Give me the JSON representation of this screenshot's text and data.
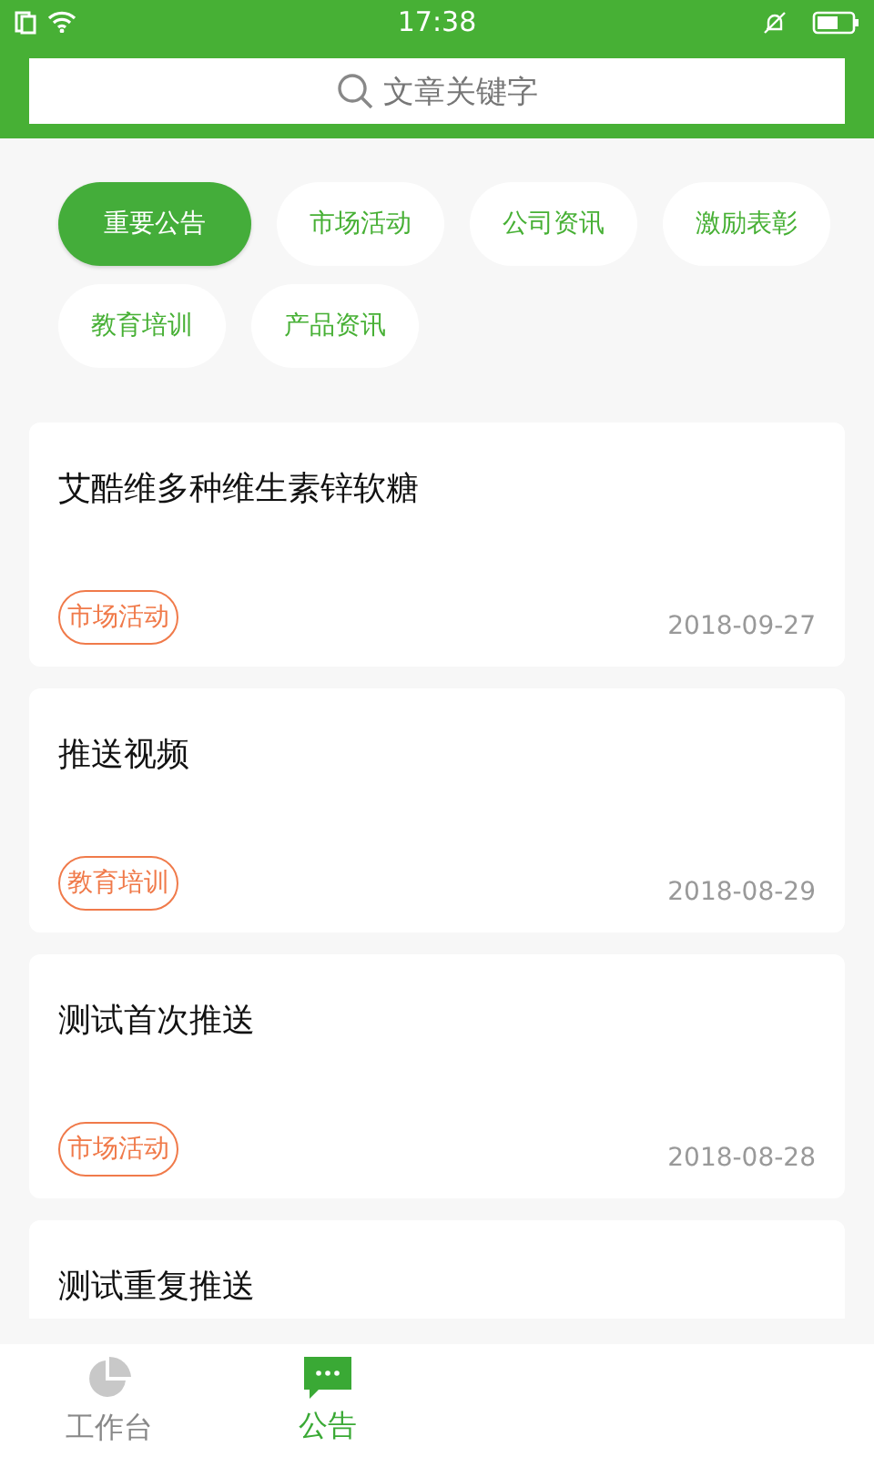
{
  "status_bar": {
    "time": "17:38"
  },
  "search": {
    "placeholder": "文章关键字"
  },
  "categories": [
    {
      "label": "重要公告",
      "selected": true
    },
    {
      "label": "市场活动",
      "selected": false
    },
    {
      "label": "公司资讯",
      "selected": false
    },
    {
      "label": "激励表彰",
      "selected": false
    },
    {
      "label": "教育培训",
      "selected": false
    },
    {
      "label": "产品资讯",
      "selected": false
    }
  ],
  "articles": [
    {
      "title": "艾酷维多种维生素锌软糖",
      "tag": "市场活动",
      "date": "2018-09-27"
    },
    {
      "title": "推送视频",
      "tag": "教育培训",
      "date": "2018-08-29"
    },
    {
      "title": "测试首次推送",
      "tag": "市场活动",
      "date": "2018-08-28"
    },
    {
      "title": "测试重复推送"
    }
  ],
  "tabs": [
    {
      "kind": "chart",
      "label": "工作台",
      "selected": false
    },
    {
      "kind": "chat",
      "label": "公告",
      "selected": true
    }
  ]
}
